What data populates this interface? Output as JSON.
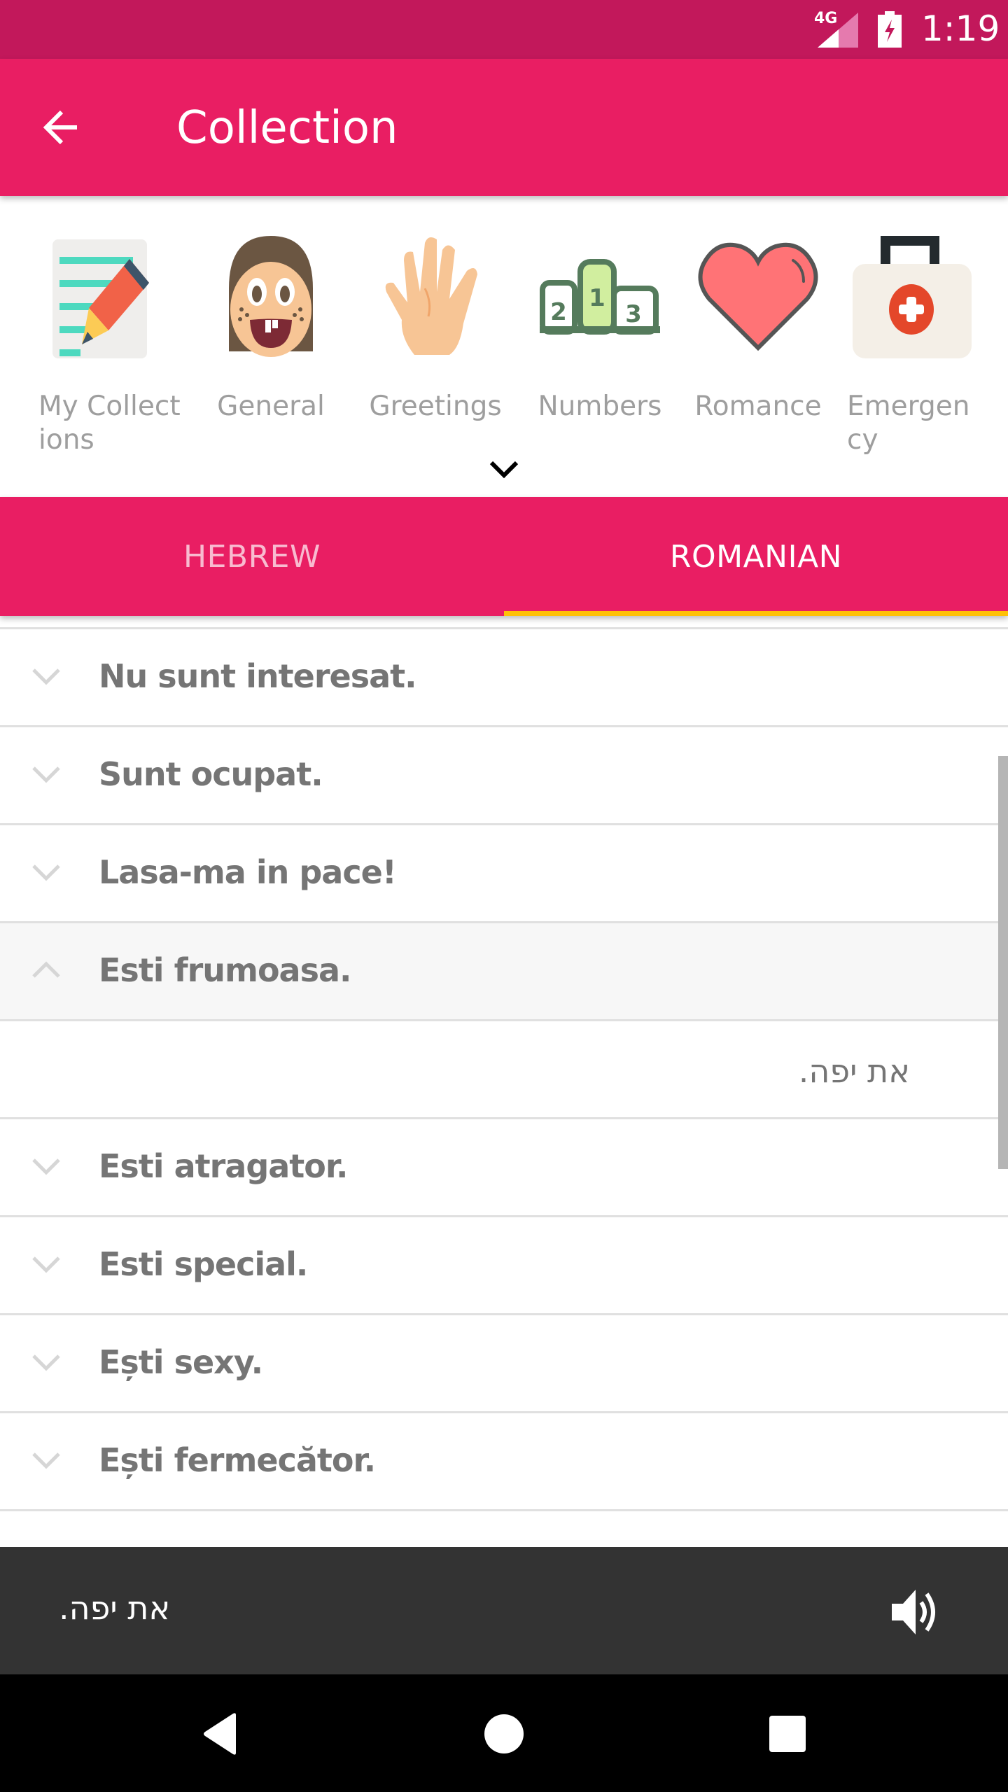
{
  "status_bar": {
    "network": "4G",
    "signal_icon": "cell-signal-icon",
    "battery_icon": "battery-charging-icon",
    "time": "1:19"
  },
  "app_bar": {
    "back_icon": "arrow-back-icon",
    "title": "Collection",
    "color": "#E91E63"
  },
  "categories": {
    "items": [
      {
        "label": "My Collect\nions",
        "icon": "notepad-pencil-icon"
      },
      {
        "label": "General",
        "icon": "smiling-face-icon"
      },
      {
        "label": "Greetings",
        "icon": "waving-hand-icon"
      },
      {
        "label": "Numbers",
        "icon": "podium-123-icon"
      },
      {
        "label": "Romance",
        "icon": "heart-icon"
      },
      {
        "label": "Emergen\ncy",
        "icon": "first-aid-kit-icon"
      }
    ],
    "expand_icon": "chevron-down-icon"
  },
  "tabs": {
    "items": [
      {
        "label": "HEBREW",
        "active": false
      },
      {
        "label": "ROMANIAN",
        "active": true
      }
    ],
    "indicator_color": "#FFC107"
  },
  "phrases": {
    "rows": [
      {
        "text": "Nu sunt interesat.",
        "expanded": false
      },
      {
        "text": "Sunt ocupat.",
        "expanded": false
      },
      {
        "text": "Lasa-ma in pace!",
        "expanded": false
      },
      {
        "text": "Esti frumoasa.",
        "expanded": true,
        "translation": "את יפה."
      },
      {
        "text": "Esti atragator.",
        "expanded": false
      },
      {
        "text": "Esti special.",
        "expanded": false
      },
      {
        "text": "Ești sexy.",
        "expanded": false
      },
      {
        "text": "Ești fermecător.",
        "expanded": false
      }
    ]
  },
  "player": {
    "text": "את יפה.",
    "speaker_icon": "volume-up-icon"
  },
  "nav_bar": {
    "back": "nav-back-icon",
    "home": "nav-home-icon",
    "recents": "nav-recents-icon"
  }
}
